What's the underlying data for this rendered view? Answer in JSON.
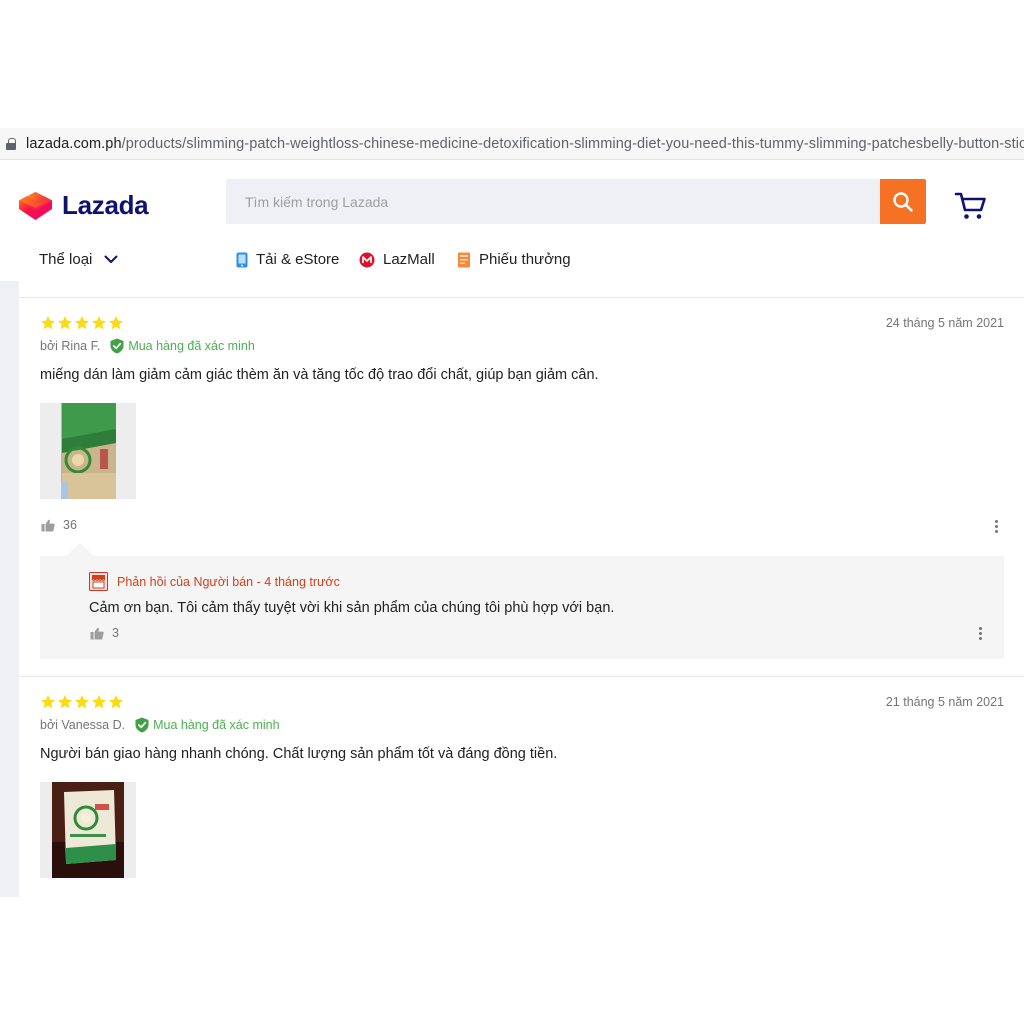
{
  "browser": {
    "url_domain": "lazada.com.ph",
    "url_path": "/products/slimming-patch-weightloss-chinese-medicine-detoxification-slimming-diet-you-need-this-tummy-slimming-patchesbelly-button-stick"
  },
  "header": {
    "logo_text": "Lazada",
    "search_placeholder": "Tìm kiếm trong Lazada",
    "brand_color": "#f57224"
  },
  "nav": {
    "category_label": "Thể loại",
    "items": [
      {
        "label": "Tải & eStore",
        "icon": "phone-app-icon"
      },
      {
        "label": "LazMall",
        "icon": "lazmall-icon"
      },
      {
        "label": "Phiếu thưởng",
        "icon": "voucher-icon"
      }
    ]
  },
  "reviews": [
    {
      "rating": 5,
      "date": "24 tháng 5 năm 2021",
      "author": "bởi Rina F.",
      "verified_label": "Mua hàng đã xác minh",
      "text": "miếng dán làm giảm cảm giác thèm ăn và tăng tốc độ trao đổi chất, giúp bạn giảm cân.",
      "likes": "36",
      "image": "product-photo",
      "seller_reply": {
        "header": "Phản hồi của Người bán - 4 tháng trước",
        "text": "Cảm ơn bạn. Tôi cảm thấy tuyệt vời khi sản phẩm của chúng tôi phù hợp với bạn.",
        "likes": "3"
      }
    },
    {
      "rating": 5,
      "date": "21 tháng 5 năm 2021",
      "author": "bởi Vanessa D.",
      "verified_label": "Mua hàng đã xác minh",
      "text": "Người bán giao hàng nhanh chóng. Chất lượng sản phẩm tốt và đáng đồng tiền.",
      "image": "product-photo"
    }
  ]
}
